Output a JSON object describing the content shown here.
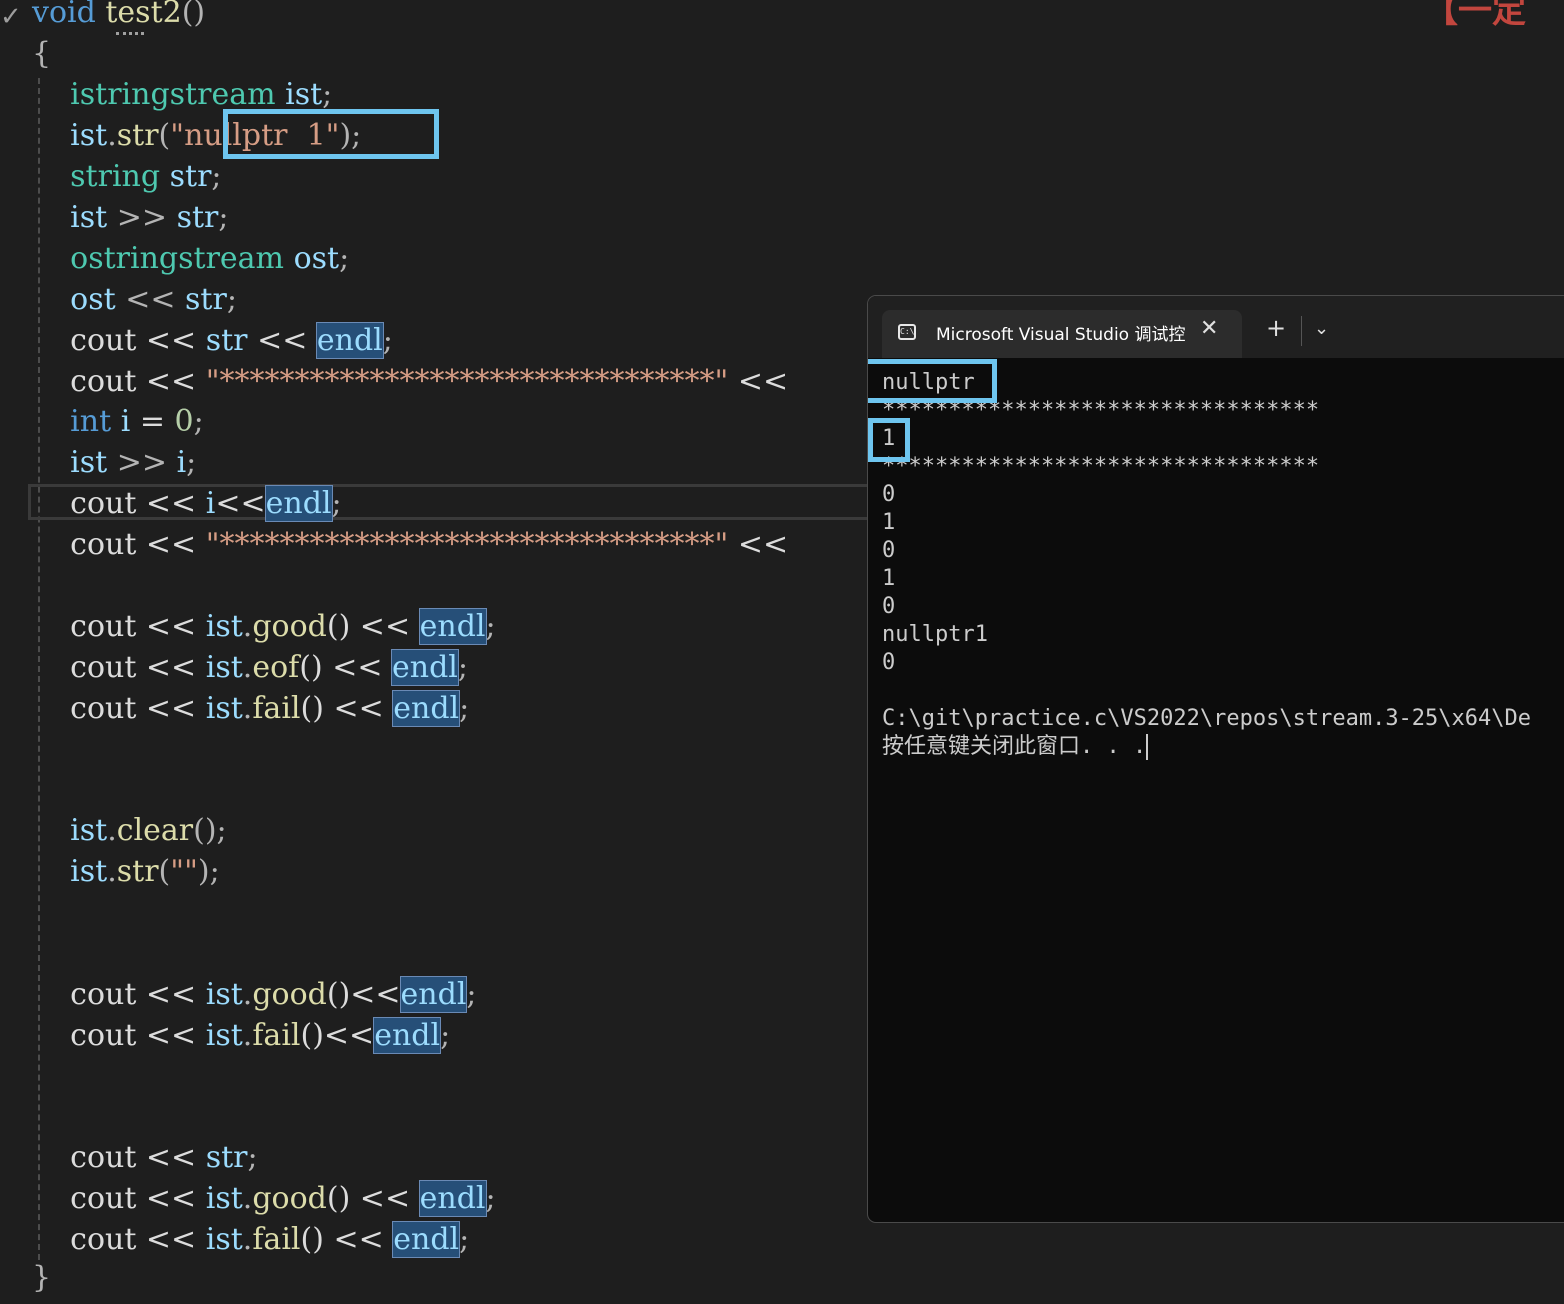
{
  "editor": {
    "fold_glyph": "✓",
    "corner_mark_text": "【一定",
    "lines": [
      [
        {
          "t": "void ",
          "c": "kw"
        },
        {
          "t": "test2",
          "c": "fn"
        },
        {
          "t": "()",
          "c": "pu"
        }
      ],
      [
        {
          "t": "{",
          "c": "pu"
        }
      ],
      [
        {
          "t": "    "
        },
        {
          "t": "istringstream",
          "c": "ty"
        },
        {
          "t": " "
        },
        {
          "t": "ist",
          "c": "va"
        },
        {
          "t": ";",
          "c": "pu"
        }
      ],
      [
        {
          "t": "    "
        },
        {
          "t": "ist",
          "c": "va"
        },
        {
          "t": ".",
          "c": "pu"
        },
        {
          "t": "str",
          "c": "fn"
        },
        {
          "t": "(",
          "c": "pu"
        },
        {
          "t": "\"nullptr  1\"",
          "c": "st"
        },
        {
          "t": ");",
          "c": "pu"
        }
      ],
      [
        {
          "t": "    "
        },
        {
          "t": "string",
          "c": "ty"
        },
        {
          "t": " "
        },
        {
          "t": "str",
          "c": "va"
        },
        {
          "t": ";",
          "c": "pu"
        }
      ],
      [
        {
          "t": "    "
        },
        {
          "t": "ist",
          "c": "va"
        },
        {
          "t": " >> ",
          "c": "pu"
        },
        {
          "t": "str",
          "c": "va"
        },
        {
          "t": ";",
          "c": "pu"
        }
      ],
      [
        {
          "t": "    "
        },
        {
          "t": "ostringstream",
          "c": "ty"
        },
        {
          "t": " "
        },
        {
          "t": "ost",
          "c": "va"
        },
        {
          "t": ";",
          "c": "pu"
        }
      ],
      [
        {
          "t": "    "
        },
        {
          "t": "ost",
          "c": "va"
        },
        {
          "t": " << ",
          "c": "pu"
        },
        {
          "t": "str",
          "c": "va"
        },
        {
          "t": ";",
          "c": "pu"
        }
      ],
      [
        {
          "t": "    cout << "
        },
        {
          "t": "str",
          "c": "va"
        },
        {
          "t": " << "
        },
        {
          "t": "endl",
          "c": "hl"
        },
        {
          "t": ";",
          "c": "pu"
        }
      ],
      [
        {
          "t": "    cout << "
        },
        {
          "t": "\"*********************************\"",
          "c": "st"
        },
        {
          "t": " <<"
        }
      ],
      [
        {
          "t": "    "
        },
        {
          "t": "int",
          "c": "kw"
        },
        {
          "t": " "
        },
        {
          "t": "i",
          "c": "va"
        },
        {
          "t": " = "
        },
        {
          "t": "0",
          "c": "nu"
        },
        {
          "t": ";",
          "c": "pu"
        }
      ],
      [
        {
          "t": "    "
        },
        {
          "t": "ist",
          "c": "va"
        },
        {
          "t": " >> ",
          "c": "pu"
        },
        {
          "t": "i",
          "c": "va"
        },
        {
          "t": ";",
          "c": "pu"
        }
      ],
      [
        {
          "t": "    cout << "
        },
        {
          "t": "i",
          "c": "va"
        },
        {
          "t": "<<"
        },
        {
          "t": "endl",
          "c": "hl"
        },
        {
          "t": ";",
          "c": "pu"
        }
      ],
      [
        {
          "t": "    cout << "
        },
        {
          "t": "\"*********************************\"",
          "c": "st"
        },
        {
          "t": " <<"
        }
      ],
      [],
      [
        {
          "t": "    cout << "
        },
        {
          "t": "ist",
          "c": "va"
        },
        {
          "t": ".",
          "c": "pu"
        },
        {
          "t": "good",
          "c": "fn"
        },
        {
          "t": "() << "
        },
        {
          "t": "endl",
          "c": "hl"
        },
        {
          "t": ";",
          "c": "pu"
        }
      ],
      [
        {
          "t": "    cout << "
        },
        {
          "t": "ist",
          "c": "va"
        },
        {
          "t": ".",
          "c": "pu"
        },
        {
          "t": "eof",
          "c": "fn"
        },
        {
          "t": "() << "
        },
        {
          "t": "endl",
          "c": "hl"
        },
        {
          "t": ";",
          "c": "pu"
        }
      ],
      [
        {
          "t": "    cout << "
        },
        {
          "t": "ist",
          "c": "va"
        },
        {
          "t": ".",
          "c": "pu"
        },
        {
          "t": "fail",
          "c": "fn"
        },
        {
          "t": "() << "
        },
        {
          "t": "endl",
          "c": "hl"
        },
        {
          "t": ";",
          "c": "pu"
        }
      ],
      [],
      [
        {
          "t": "    "
        },
        {
          "t": "ist",
          "c": "va"
        },
        {
          "t": ".",
          "c": "pu"
        },
        {
          "t": "clear",
          "c": "fn"
        },
        {
          "t": "();",
          "c": "pu"
        }
      ],
      [
        {
          "t": "    "
        },
        {
          "t": "ist",
          "c": "va"
        },
        {
          "t": ".",
          "c": "pu"
        },
        {
          "t": "str",
          "c": "fn"
        },
        {
          "t": "(",
          "c": "pu"
        },
        {
          "t": "\"\"",
          "c": "st"
        },
        {
          "t": ");",
          "c": "pu"
        }
      ],
      [],
      [
        {
          "t": "    cout << "
        },
        {
          "t": "ist",
          "c": "va"
        },
        {
          "t": ".",
          "c": "pu"
        },
        {
          "t": "good",
          "c": "fn"
        },
        {
          "t": "()<<"
        },
        {
          "t": "endl",
          "c": "hl"
        },
        {
          "t": ";",
          "c": "pu"
        }
      ],
      [
        {
          "t": "    cout << "
        },
        {
          "t": "ist",
          "c": "va"
        },
        {
          "t": ".",
          "c": "pu"
        },
        {
          "t": "fail",
          "c": "fn"
        },
        {
          "t": "()<<"
        },
        {
          "t": "endl",
          "c": "hl"
        },
        {
          "t": ";",
          "c": "pu"
        }
      ],
      [],
      [
        {
          "t": "    cout << "
        },
        {
          "t": "str",
          "c": "va"
        },
        {
          "t": ";",
          "c": "pu"
        }
      ],
      [
        {
          "t": "    cout << "
        },
        {
          "t": "ist",
          "c": "va"
        },
        {
          "t": ".",
          "c": "pu"
        },
        {
          "t": "good",
          "c": "fn"
        },
        {
          "t": "() << "
        },
        {
          "t": "endl",
          "c": "hl"
        },
        {
          "t": ";",
          "c": "pu"
        }
      ],
      [
        {
          "t": "    cout << "
        },
        {
          "t": "ist",
          "c": "va"
        },
        {
          "t": ".",
          "c": "pu"
        },
        {
          "t": "fail",
          "c": "fn"
        },
        {
          "t": "() << "
        },
        {
          "t": "endl",
          "c": "hl"
        },
        {
          "t": ";",
          "c": "pu"
        }
      ],
      [
        {
          "t": "}",
          "c": "pu"
        }
      ]
    ]
  },
  "console": {
    "tab_title": "Microsoft Visual Studio 调试控",
    "tab_icon": "C:\\",
    "close_glyph": "✕",
    "new_tab_glyph": "+",
    "dropdown_glyph": "⌄",
    "output": [
      "nullptr",
      "*********************************",
      "1",
      "*********************************",
      "0",
      "1",
      "0",
      "1",
      "0",
      "nullptr1",
      "0",
      "",
      "C:\\git\\practice.c\\VS2022\\repos\\stream.3-25\\x64\\De",
      "按任意键关闭此窗口. . ."
    ]
  }
}
